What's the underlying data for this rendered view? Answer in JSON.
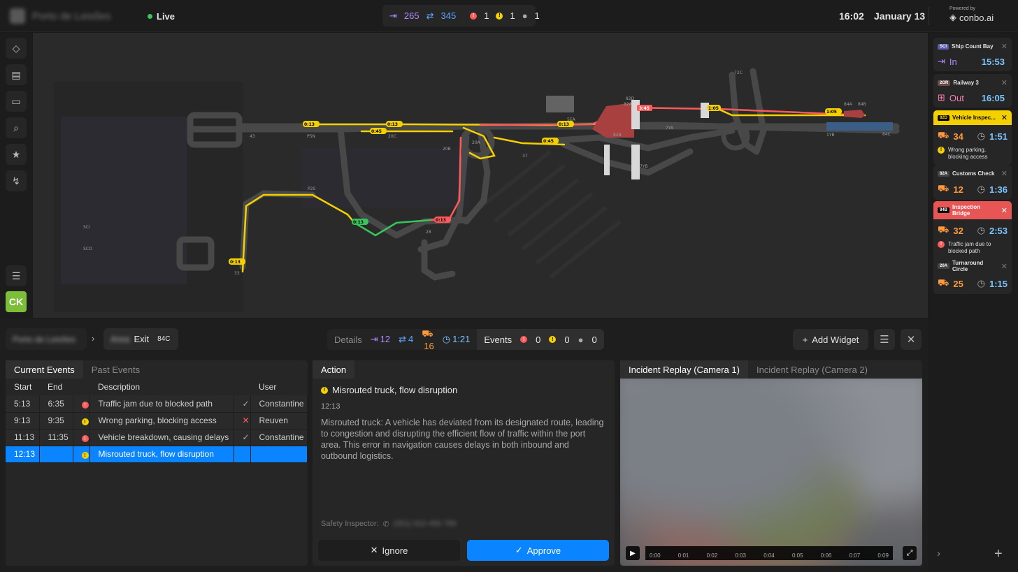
{
  "header": {
    "live_label": "Live",
    "stats": {
      "in": "265",
      "out": "345",
      "errors": "1",
      "warnings": "1",
      "comments": "1"
    },
    "time": "16:02",
    "date": "January 13",
    "powered_by": "Powered by",
    "brand": "conbo.ai"
  },
  "map": {
    "labels": [
      "43",
      "P5N",
      "20C",
      "20B",
      "20A",
      "5EA",
      "37",
      "82B",
      "7YA",
      "1YB",
      "84C",
      "82A",
      "7YB",
      "72C",
      "84A",
      "84B",
      "82D",
      "P2S",
      "SCI",
      "SCO",
      "28",
      "33"
    ],
    "badges": [
      "0:13",
      "0:45",
      "0:13",
      "0:45",
      "0:13",
      "0:13",
      "0:13",
      "0:13",
      "3:45",
      "1:05",
      "1:05",
      "0:45"
    ]
  },
  "right_cards": [
    {
      "tag": "SCI",
      "title": "Ship Count Bay",
      "dir": "In",
      "time": "15:53",
      "state": "normal"
    },
    {
      "tag": "2OR",
      "title": "Railway 3",
      "dir": "Out",
      "time": "16:05",
      "state": "normal"
    },
    {
      "tag": "82D",
      "title": "Vehicle Inspec...",
      "count": "34",
      "dur": "1:51",
      "note": "Wrong parking, blocking access",
      "state": "warning"
    },
    {
      "tag": "82A",
      "title": "Customs Check",
      "count": "12",
      "dur": "1:36",
      "state": "normal"
    },
    {
      "tag": "84B",
      "title": "Inspection Bridge",
      "count": "32",
      "dur": "2:53",
      "note": "Traffic jam due to blocked path",
      "state": "error"
    },
    {
      "tag": "20A",
      "title": "Turnaround Circle",
      "count": "25",
      "dur": "1:15",
      "state": "normal"
    }
  ],
  "breadcrumb": {
    "root": "Porto de Leixões",
    "exit_label": "Exit",
    "exit_tag": "84C"
  },
  "details_bar": {
    "details_label": "Details",
    "in": "12",
    "out": "4",
    "trucks": "16",
    "time": "1:21",
    "events_label": "Events",
    "errors": "0",
    "warnings": "0",
    "comments": "0"
  },
  "toolbar": {
    "add_widget": "Add Widget"
  },
  "events_panel": {
    "tab_current": "Current Events",
    "tab_past": "Past Events",
    "columns": [
      "Start",
      "End",
      "",
      "Description",
      "",
      "User"
    ],
    "rows": [
      {
        "start": "5:13",
        "end": "6:35",
        "level": "error",
        "desc": "Traffic jam due to blocked path",
        "status": "check",
        "user": "Constantine"
      },
      {
        "start": "9:13",
        "end": "9:35",
        "level": "warning",
        "desc": "Wrong parking, blocking access",
        "status": "cross",
        "user": "Reuven"
      },
      {
        "start": "11:13",
        "end": "11:35",
        "level": "error",
        "desc": "Vehicle breakdown, causing delays",
        "status": "check",
        "user": "Constantine"
      },
      {
        "start": "12:13",
        "end": "",
        "level": "warning",
        "desc": "Misrouted truck, flow disruption",
        "status": "",
        "user": ""
      }
    ]
  },
  "action_panel": {
    "tab": "Action",
    "title": "Misrouted truck, flow disruption",
    "time": "12:13",
    "body": "Misrouted truck: A vehicle has deviated from its designated route, leading to congestion and disrupting the efficient flow of traffic within the port area. This error in navigation causes delays in both inbound and outbound logistics.",
    "inspector_label": "Safety Inspector:",
    "inspector_phone": "(351) 910 456 789",
    "ignore": "Ignore",
    "approve": "Approve"
  },
  "replay_panel": {
    "tab1": "Incident Replay (Camera 1)",
    "tab2": "Incident Replay (Camera 2)",
    "ticks": [
      "0:00",
      "0:01",
      "0:02",
      "0:03",
      "0:04",
      "0:05",
      "0:06",
      "0:07",
      "0:09"
    ]
  },
  "colors": {
    "accent": "#0a84ff",
    "warning": "#f5d000",
    "error": "#ff5a5a",
    "ok": "#37c65b",
    "in": "#b08aff",
    "out": "#5aa8ff",
    "truck": "#ff9a3c",
    "time_blue": "#7cc4ff"
  }
}
